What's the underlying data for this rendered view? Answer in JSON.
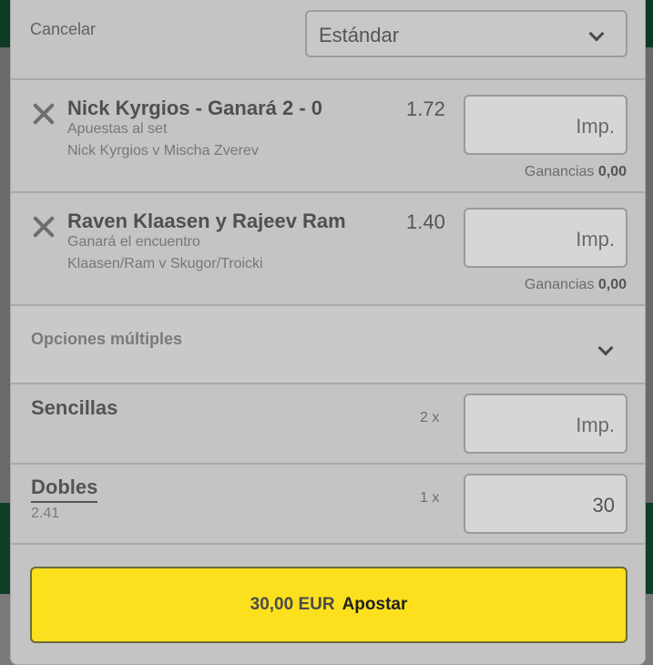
{
  "header": {
    "cancel_label": "Cancelar",
    "mode_selected": "Estándar"
  },
  "bets": [
    {
      "title": "Nick Kyrgios - Ganará 2 - 0",
      "market": "Apuestas al set",
      "event": "Nick Kyrgios v Mischa Zverev",
      "odds": "1.72",
      "stake_placeholder": "Imp.",
      "winnings_label": "Ganancias",
      "winnings_value": "0,00"
    },
    {
      "title": "Raven Klaasen y Rajeev Ram",
      "market": "Ganará el encuentro",
      "event": "Klaasen/Ram v Skugor/Troicki",
      "odds": "1.40",
      "stake_placeholder": "Imp.",
      "winnings_label": "Ganancias",
      "winnings_value": "0,00"
    }
  ],
  "multiples": {
    "label": "Opciones múltiples"
  },
  "singles": {
    "label": "Sencillas",
    "multiplier": "2 x",
    "stake_placeholder": "Imp."
  },
  "doubles": {
    "label": "Dobles",
    "odds": "2.41",
    "multiplier": "1 x",
    "stake_value": "30"
  },
  "place_bet": {
    "amount": "30,00 EUR",
    "label": "Apostar"
  },
  "colors": {
    "accent_button": "#fce01e",
    "panel": "#c4c4c4",
    "brand_dark_green": "#0c3a25"
  },
  "icons": [
    "remove-bet-icon",
    "chevron-down-icon"
  ]
}
